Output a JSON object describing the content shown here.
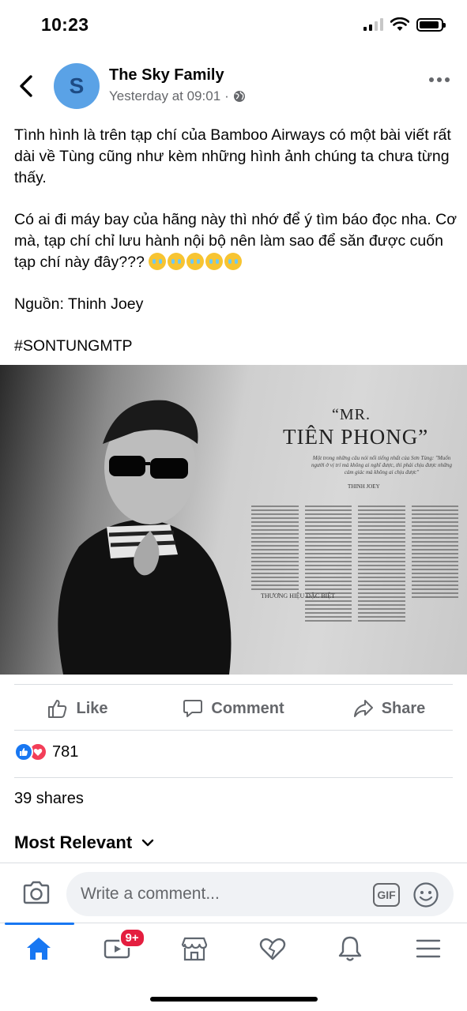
{
  "status_bar": {
    "time": "10:23"
  },
  "post": {
    "author": "The Sky Family",
    "avatar_letter": "S",
    "timestamp": "Yesterday at 09:01",
    "meta_separator": "·",
    "paragraph_1": "Tình hình là trên tạp chí của Bamboo Airways có một bài viết rất dài về Tùng cũng như kèm những hình ảnh chúng ta chưa từng thấy.",
    "paragraph_2": "Có ai đi máy bay của hãng này thì nhớ để ý tìm báo đọc nha. Cơ mà, tạp chí chỉ lưu hành nội bộ nên làm sao để săn được cuốn tạp chí này đây???",
    "paragraph_3": "Nguồn: Thinh Joey",
    "hashtag": "#SONTUNGMTP"
  },
  "photo": {
    "title_small": "“MR.",
    "title": "TIÊN PHONG”",
    "subtitle": "Một trong những câu nói nổi tiếng nhất của Sơn Tùng: \"Muốn người ở vị trí mà không ai nghĩ được, thì phải chịu được những cảm giác mà không ai chịu được\"",
    "author": "THINH JOEY",
    "section_heading": "THƯƠNG HIỆU ĐẶC BIỆT"
  },
  "actions": {
    "like_label": "Like",
    "comment_label": "Comment",
    "share_label": "Share"
  },
  "stats": {
    "reaction_count": "781",
    "shares": "39 shares"
  },
  "comments": {
    "sort_label": "Most Relevant",
    "composer_placeholder": "Write a comment...",
    "gif_label": "GIF"
  },
  "tabbar": {
    "watch_badge": "9+"
  },
  "colors": {
    "accent": "#1877f2",
    "secondary_text": "#65676b",
    "love": "#f33e58",
    "badge": "#e41e3f"
  }
}
